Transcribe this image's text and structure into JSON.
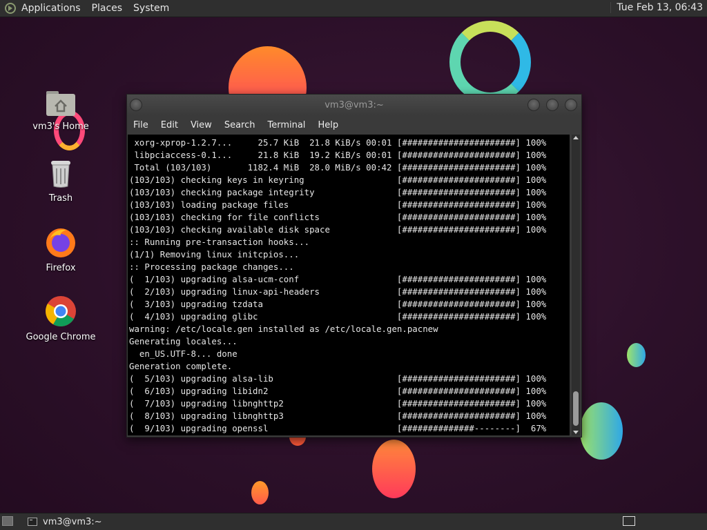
{
  "topbar": {
    "menus": [
      "Applications",
      "Places",
      "System"
    ],
    "clock": "Tue Feb 13, 06:43"
  },
  "desktop_icons": [
    {
      "label": "vm3's Home",
      "icon": "home-folder-icon"
    },
    {
      "label": "Trash",
      "icon": "trash-icon"
    },
    {
      "label": "Firefox",
      "icon": "firefox-icon"
    },
    {
      "label": "Google Chrome",
      "icon": "chrome-icon"
    }
  ],
  "window": {
    "title": "vm3@vm3:~",
    "menu": [
      "File",
      "Edit",
      "View",
      "Search",
      "Terminal",
      "Help"
    ],
    "terminal_lines": [
      " xorg-xprop-1.2.7...     25.7 KiB  21.8 KiB/s 00:01 [######################] 100%",
      " libpciaccess-0.1...     21.8 KiB  19.2 KiB/s 00:01 [######################] 100%",
      " Total (103/103)       1182.4 MiB  28.0 MiB/s 00:42 [######################] 100%",
      "(103/103) checking keys in keyring                  [######################] 100%",
      "(103/103) checking package integrity                [######################] 100%",
      "(103/103) loading package files                     [######################] 100%",
      "(103/103) checking for file conflicts               [######################] 100%",
      "(103/103) checking available disk space             [######################] 100%",
      ":: Running pre-transaction hooks...",
      "(1/1) Removing linux initcpios...",
      ":: Processing package changes...",
      "(  1/103) upgrading alsa-ucm-conf                   [######################] 100%",
      "(  2/103) upgrading linux-api-headers               [######################] 100%",
      "(  3/103) upgrading tzdata                          [######################] 100%",
      "(  4/103) upgrading glibc                           [######################] 100%",
      "warning: /etc/locale.gen installed as /etc/locale.gen.pacnew",
      "Generating locales...",
      "  en_US.UTF-8... done",
      "Generation complete.",
      "(  5/103) upgrading alsa-lib                        [######################] 100%",
      "(  6/103) upgrading libidn2                         [######################] 100%",
      "(  7/103) upgrading libnghttp2                      [######################] 100%",
      "(  8/103) upgrading libnghttp3                      [######################] 100%",
      "(  9/103) upgrading openssl                         [##############--------]  67%"
    ]
  },
  "taskbar": {
    "task_label": "vm3@vm3:~"
  }
}
